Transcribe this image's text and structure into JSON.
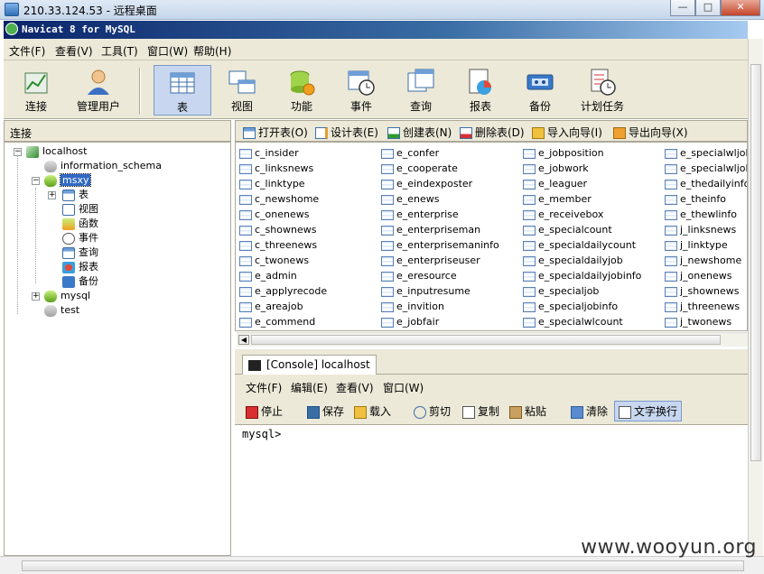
{
  "rdp": {
    "title": "210.33.124.53 - 远程桌面",
    "buttons": [
      "—",
      "□",
      "✕"
    ]
  },
  "app": {
    "title": "Navicat 8 for MySQL"
  },
  "menu": [
    "文件(F)",
    "查看(V)",
    "工具(T)",
    "窗口(W)",
    "帮助(H)"
  ],
  "toolbar": [
    {
      "label": "连接",
      "icon": "connection-icon"
    },
    {
      "label": "管理用户",
      "icon": "user-icon"
    },
    {
      "label": "表",
      "icon": "table-icon",
      "selected": true
    },
    {
      "label": "视图",
      "icon": "view-icon"
    },
    {
      "label": "功能",
      "icon": "function-icon"
    },
    {
      "label": "事件",
      "icon": "event-icon"
    },
    {
      "label": "查询",
      "icon": "query-icon"
    },
    {
      "label": "报表",
      "icon": "report-icon"
    },
    {
      "label": "备份",
      "icon": "backup-icon"
    },
    {
      "label": "计划任务",
      "icon": "schedule-icon"
    }
  ],
  "left": {
    "header": "连接",
    "tree": {
      "localhost": "localhost",
      "information_schema": "information_schema",
      "msxy": "msxy",
      "tables": "表",
      "views": "视图",
      "functions": "函数",
      "events": "事件",
      "queries": "查询",
      "reports": "报表",
      "backups": "备份",
      "mysql": "mysql",
      "test": "test"
    }
  },
  "object_toolbar": [
    "打开表(O)",
    "设计表(E)",
    "创建表(N)",
    "删除表(D)",
    "导入向导(I)",
    "导出向导(X)"
  ],
  "tables": [
    [
      "c_insider",
      "c_linksnews",
      "c_linktype",
      "c_newshome",
      "c_onenews",
      "c_shownews",
      "c_threenews",
      "c_twonews",
      "e_admin",
      "e_applyrecode",
      "e_areajob",
      "e_commend"
    ],
    [
      "e_confer",
      "e_cooperate",
      "e_eindexposter",
      "e_enews",
      "e_enterprise",
      "e_enterpriseman",
      "e_enterprisemaninfo",
      "e_enterpriseuser",
      "e_eresource",
      "e_inputresume",
      "e_invition",
      "e_jobfair"
    ],
    [
      "e_jobposition",
      "e_jobwork",
      "e_leaguer",
      "e_member",
      "e_receivebox",
      "e_specialcount",
      "e_specialdailycount",
      "e_specialdailyjob",
      "e_specialdailyjobinfo",
      "e_specialjob",
      "e_specialjobinfo",
      "e_specialwlcount"
    ],
    [
      "e_specialwljob",
      "e_specialwljobir",
      "e_thedailyinfo",
      "e_theinfo",
      "e_thewlinfo",
      "j_linksnews",
      "j_linktype",
      "j_newshome",
      "j_onenews",
      "j_shownews",
      "j_threenews",
      "j_twonews"
    ]
  ],
  "console": {
    "tab": "[Console] localhost",
    "menu": [
      "文件(F)",
      "编辑(E)",
      "查看(V)",
      "窗口(W)"
    ],
    "toolbar": {
      "stop": "停止",
      "save": "保存",
      "load": "载入",
      "cut": "剪切",
      "copy": "复制",
      "paste": "粘贴",
      "clear": "清除",
      "wrap": "文字换行"
    },
    "prompt": "mysql>"
  },
  "watermark": "www.wooyun.org",
  "colors": {
    "title_gradient_start": "#0a246a",
    "title_gradient_end": "#a6caf0",
    "face": "#ece9d8",
    "selection": "#316ac5"
  }
}
